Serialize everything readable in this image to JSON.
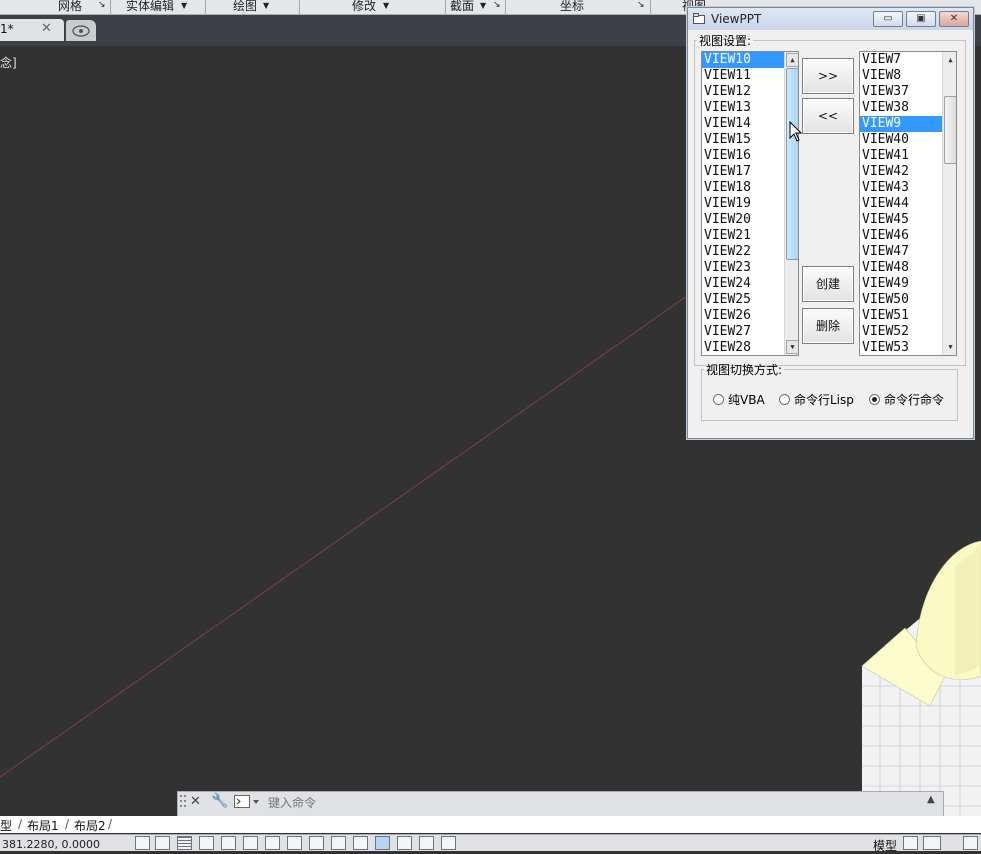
{
  "ribbon": {
    "panels": [
      "网格",
      "实体编辑",
      "绘图",
      "修改",
      "截面",
      "坐标",
      "视图"
    ]
  },
  "document": {
    "tab_label": "1*",
    "viewport_label": "念]"
  },
  "dialog": {
    "title": "ViewPPT",
    "view_settings_label": "视图设置:",
    "left_list": [
      "VIEW10",
      "VIEW11",
      "VIEW12",
      "VIEW13",
      "VIEW14",
      "VIEW15",
      "VIEW16",
      "VIEW17",
      "VIEW18",
      "VIEW19",
      "VIEW20",
      "VIEW21",
      "VIEW22",
      "VIEW23",
      "VIEW24",
      "VIEW25",
      "VIEW26",
      "VIEW27",
      "VIEW28"
    ],
    "left_selected_index": 0,
    "right_list": [
      "VIEW7",
      "VIEW8",
      "VIEW37",
      "VIEW38",
      "VIEW9",
      "VIEW40",
      "VIEW41",
      "VIEW42",
      "VIEW43",
      "VIEW44",
      "VIEW45",
      "VIEW46",
      "VIEW47",
      "VIEW48",
      "VIEW49",
      "VIEW50",
      "VIEW51",
      "VIEW52",
      "VIEW53"
    ],
    "right_selected_index": 4,
    "add_label": ">>",
    "remove_label": "<<",
    "create_label": "创建",
    "delete_label": "删除",
    "switch_mode_label": "视图切换方式:",
    "options": [
      "纯VBA",
      "命令行Lisp",
      "命令行命令"
    ],
    "selected_option": 2
  },
  "command_line": {
    "placeholder": "键入命令"
  },
  "layout_tabs": [
    "型",
    "布局1",
    "布局2"
  ],
  "status": {
    "coords": "381.2280, 0.0000",
    "model_label": "模型"
  },
  "colors": {
    "canvas": "#323232",
    "selection": "#3399ff",
    "scroll_thumb": "#a9d5f5"
  }
}
